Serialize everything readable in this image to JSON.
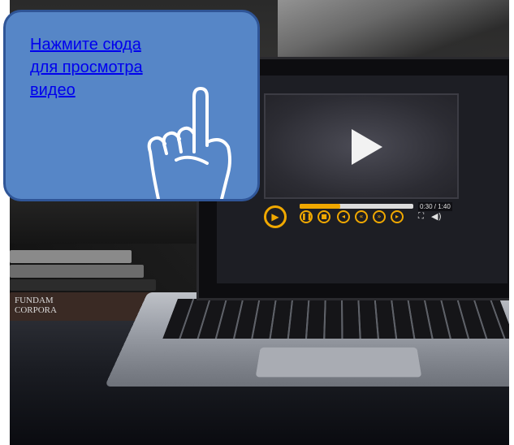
{
  "callout": {
    "link_text": "Нажмите сюда\nдля просмотра\nвидео",
    "background": "#5686c7",
    "border": "#2f5597",
    "link_color": "#0000ee"
  },
  "player": {
    "time": "0:30 / 1:40",
    "progress": 0.36,
    "accent": "#f0a800",
    "buttons": [
      "play",
      "pause",
      "stop",
      "skip-back",
      "rewind",
      "fast-forward",
      "skip-forward",
      "fullscreen",
      "volume"
    ]
  },
  "books": {
    "spines": [
      "FUNDAM",
      "CORPORA"
    ]
  }
}
